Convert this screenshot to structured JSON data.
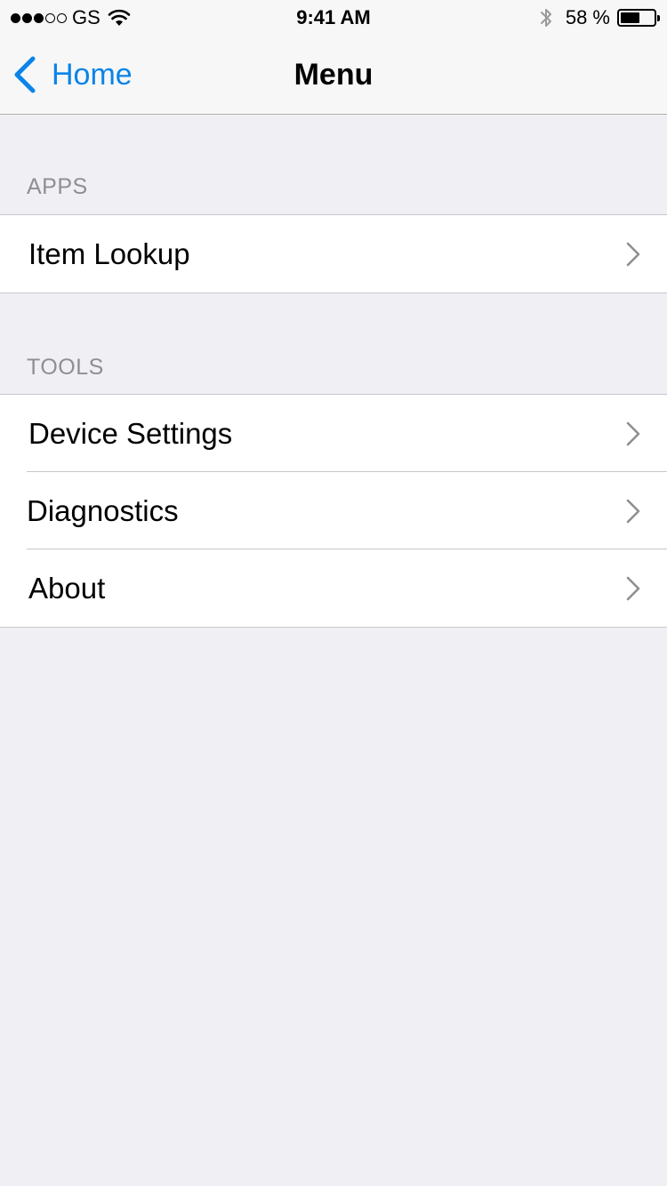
{
  "status_bar": {
    "carrier": "GS",
    "time": "9:41 AM",
    "battery_percent": "58 %",
    "battery_level": 0.58,
    "signal_bars_filled": 3,
    "signal_bars_total": 5
  },
  "nav": {
    "back_label": "Home",
    "title": "Menu"
  },
  "sections": {
    "apps": {
      "header": "APPS",
      "items": [
        "Item Lookup"
      ]
    },
    "tools": {
      "header": "TOOLS",
      "items": [
        "Device Settings",
        "Diagnostics",
        "About"
      ]
    }
  },
  "colors": {
    "accent": "#0a84e8",
    "background": "#efeff4",
    "section_header": "#8e8e93",
    "separator": "#c8c7cc",
    "chevron": "#c7c7cc"
  },
  "icons": {
    "back": "chevron-left-icon",
    "disclosure": "chevron-right-icon",
    "wifi": "wifi-icon",
    "bluetooth": "bluetooth-icon",
    "battery": "battery-icon"
  }
}
